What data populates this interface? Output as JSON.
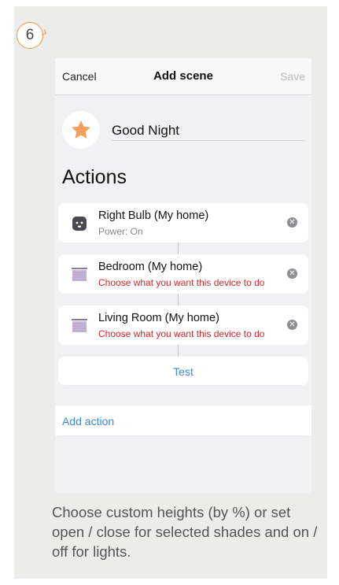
{
  "step_number": "6",
  "nav": {
    "cancel_label": "Cancel",
    "title": "Add scene",
    "save_label": "Save"
  },
  "scene": {
    "icon": "star-icon",
    "name": "Good Night"
  },
  "actions_heading": "Actions",
  "actions": [
    {
      "icon": "bulb-socket-icon",
      "title": "Right Bulb (My home)",
      "subtitle": "Power: On",
      "subtitle_state": "normal"
    },
    {
      "icon": "shade-icon",
      "title": "Bedroom (My home)",
      "subtitle": "Choose what you want this device to do",
      "subtitle_state": "warning"
    },
    {
      "icon": "shade-icon",
      "title": "Living Room (My home)",
      "subtitle": "Choose what you want this device to do",
      "subtitle_state": "warning"
    }
  ],
  "test_label": "Test",
  "add_action_label": "Add action",
  "caption": "Choose custom heights (by %) or set open / close for selected shades and on / off for lights.",
  "colors": {
    "accent_orange": "#f0953a",
    "link_blue": "#3a8ad6",
    "warning_red": "#d0272a",
    "star": "#f5a05a"
  }
}
